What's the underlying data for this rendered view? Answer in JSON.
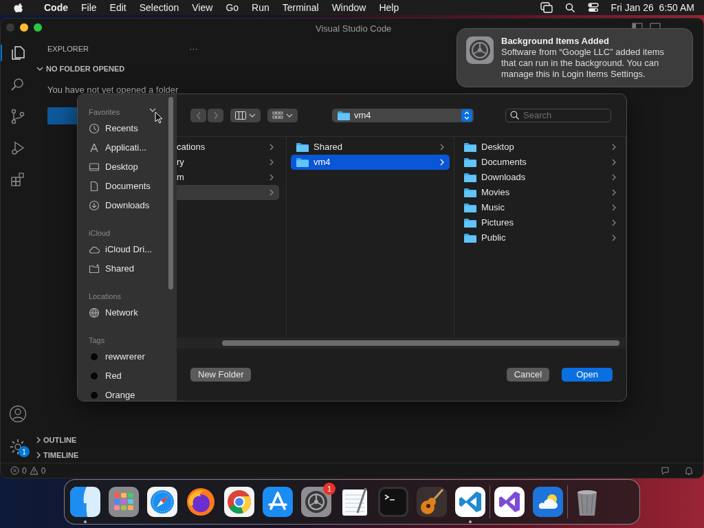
{
  "menu_bar": {
    "app": "Code",
    "menus": [
      "File",
      "Edit",
      "Selection",
      "View",
      "Go",
      "Run",
      "Terminal",
      "Window",
      "Help"
    ],
    "clock": "Fri Jan 26  6:50 AM"
  },
  "vscode": {
    "title": "Visual Studio Code",
    "activity_bar": [
      {
        "selected": true
      },
      {
        "selected": false
      },
      {
        "selected": false
      },
      {
        "selected": false
      },
      {
        "selected": false
      }
    ],
    "settings_badge": "1",
    "explorer": {
      "title": "EXPLORER",
      "more": "···",
      "section": {
        "title": "NO FOLDER OPENED",
        "expanded": true
      },
      "message": "You have not yet opened a folder",
      "bottom_sections": [
        {
          "title": "OUTLINE",
          "expanded": false
        },
        {
          "title": "TIMELINE",
          "expanded": false
        }
      ]
    },
    "status_bar": {
      "errors": "0",
      "warnings": "0"
    }
  },
  "dialog": {
    "sidebar": [
      {
        "title": "Favorites",
        "items": [
          {
            "kind": "recents",
            "label": "Recents"
          },
          {
            "kind": "applications",
            "label": "Applicati..."
          },
          {
            "kind": "desktop",
            "label": "Desktop"
          },
          {
            "kind": "documents",
            "label": "Documents"
          },
          {
            "kind": "downloads",
            "label": "Downloads"
          }
        ]
      },
      {
        "title": "iCloud",
        "items": [
          {
            "kind": "cloud",
            "label": "iCloud Dri..."
          },
          {
            "kind": "shared",
            "label": "Shared"
          }
        ]
      },
      {
        "title": "Locations",
        "items": [
          {
            "kind": "network",
            "label": "Network"
          }
        ]
      },
      {
        "title": "Tags",
        "items": [
          {
            "kind": "tag",
            "label": "rewwrerer"
          },
          {
            "kind": "tag",
            "label": "Red"
          },
          {
            "kind": "tag",
            "label": "Orange"
          }
        ]
      }
    ],
    "toolbar": {
      "back_disabled": true,
      "forward_disabled": true
    },
    "path": "vm4",
    "search": {
      "placeholder": "Search"
    },
    "columns": [
      {
        "items": [
          {
            "label": "cations",
            "selected": false
          },
          {
            "label": "ry",
            "selected": false
          },
          {
            "label": "m",
            "selected": false
          },
          {
            "selected": true
          }
        ]
      },
      {
        "items": [
          {
            "label": "Shared",
            "selected": false
          },
          {
            "label": "vm4",
            "selected": true
          }
        ]
      },
      {
        "items": [
          {
            "label": "Desktop",
            "selected": false
          },
          {
            "label": "Documents",
            "selected": false
          },
          {
            "label": "Downloads",
            "selected": false
          },
          {
            "label": "Movies",
            "selected": false
          },
          {
            "label": "Music",
            "selected": false
          },
          {
            "label": "Pictures",
            "selected": false
          },
          {
            "label": "Public",
            "selected": false
          }
        ]
      }
    ],
    "new_folder": "New Folder",
    "buttons": [
      {
        "label": "Cancel",
        "primary": false
      },
      {
        "label": "Open",
        "primary": true
      }
    ]
  },
  "notification": {
    "title": "Background Items Added",
    "body": "Software from “Google LLC” added items that can run in the background. You can manage this in Login Items Settings."
  },
  "dock": {
    "items": [
      {
        "kind": "app",
        "running": true
      },
      {
        "kind": "app"
      },
      {
        "kind": "app"
      },
      {
        "kind": "app"
      },
      {
        "kind": "app"
      },
      {
        "kind": "app"
      },
      {
        "kind": "app",
        "badge": "1"
      },
      {
        "kind": "app"
      },
      {
        "kind": "app"
      },
      {
        "kind": "app"
      },
      {
        "kind": "app",
        "running": true
      },
      {
        "kind": "separator"
      },
      {
        "kind": "app"
      },
      {
        "kind": "app"
      },
      {
        "kind": "separator"
      },
      {
        "kind": "app"
      }
    ]
  }
}
